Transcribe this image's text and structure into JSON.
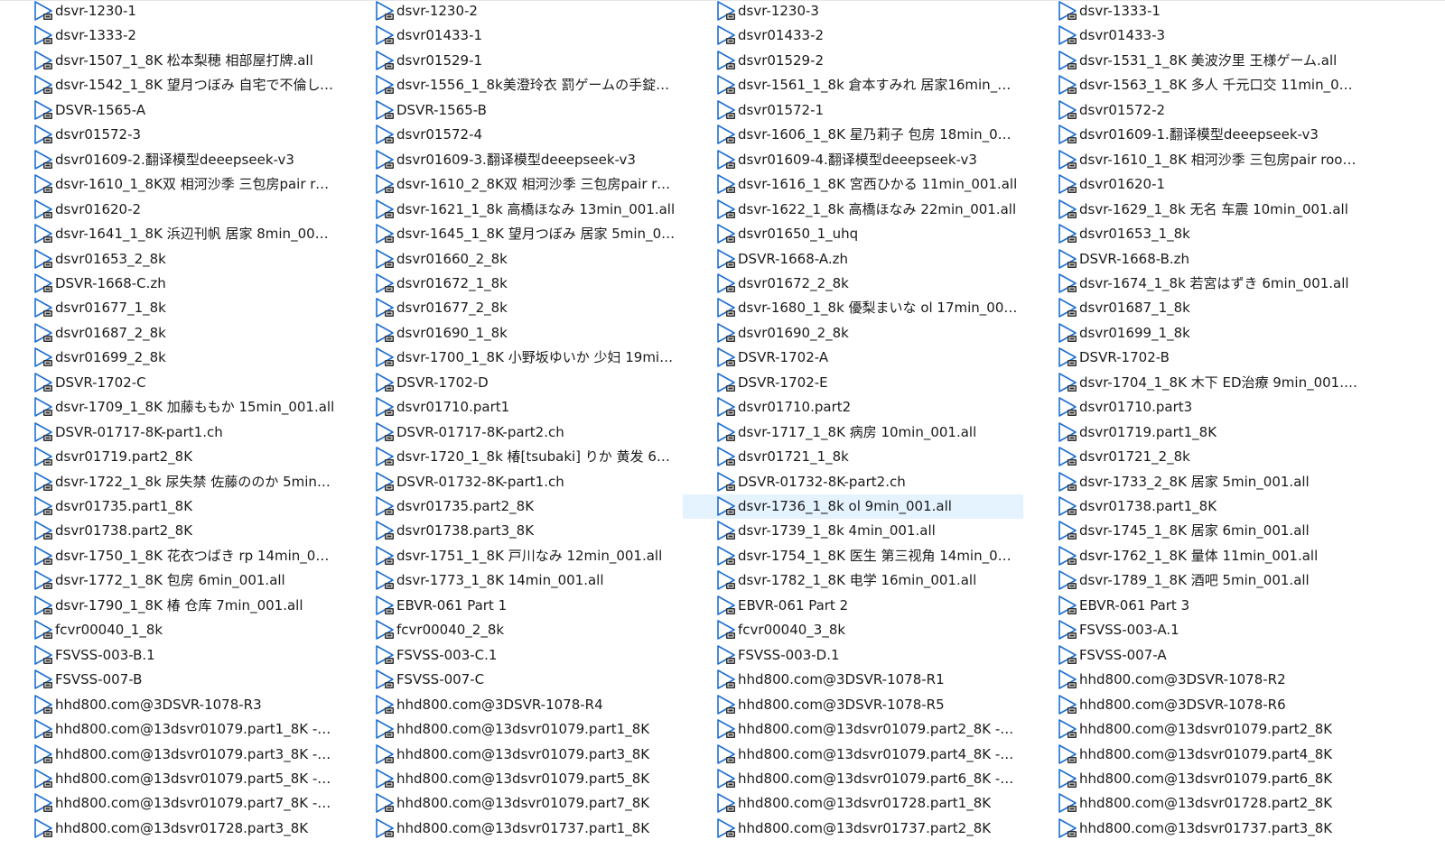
{
  "colors": {
    "selection": "#e5f3ff",
    "icon_blue": "#1f6fd1",
    "icon_dark": "#2b2b2b"
  },
  "icon": "video-file-icon",
  "columns": [
    {
      "items": [
        "dsvr-1230-1",
        "dsvr-1333-2",
        "dsvr-1507_1_8K 松本梨穂 相部屋打牌.all",
        "dsvr-1542_1_8K 望月つぼみ 自宅で不倫して…",
        "DSVR-1565-A",
        "dsvr01572-3",
        "dsvr01609-2.翻译模型deeepseek-v3",
        "dsvr-1610_1_8K双 相河沙季 三包房pair room",
        "dsvr01620-2",
        "dsvr-1641_1_8K 浜辺刊帆 居家 8min_001.all",
        "dsvr01653_2_8k",
        "DSVR-1668-C.zh",
        "dsvr01677_1_8k",
        "dsvr01687_2_8k",
        "dsvr01699_2_8k",
        "DSVR-1702-C",
        "dsvr-1709_1_8K 加藤ももか 15min_001.all",
        "DSVR-01717-8K-part1.ch",
        "dsvr01719.part2_8K",
        "dsvr-1722_1_8k 尿失禁 佐藤ののか 5min_0…",
        "dsvr01735.part1_8K",
        "dsvr01738.part2_8K",
        "dsvr-1750_1_8K 花衣つばき rp 14min_001.…",
        "dsvr-1772_1_8K 包房 6min_001.all",
        "dsvr-1790_1_8K 椿  仓库 7min_001.all",
        "fcvr00040_1_8k",
        "FSVSS-003-B.1",
        "FSVSS-007-B",
        "hhd800.com@3DSVR-1078-R3",
        "hhd800.com@13dsvr01079.part1_8K - 副本",
        "hhd800.com@13dsvr01079.part3_8K - 副本",
        "hhd800.com@13dsvr01079.part5_8K - 副本",
        "hhd800.com@13dsvr01079.part7_8K - 副本",
        "hhd800.com@13dsvr01728.part3_8K"
      ]
    },
    {
      "items": [
        "dsvr-1230-2",
        "dsvr01433-1",
        "dsvr01529-1",
        "dsvr-1556_1_8k美澄玲衣 罰ゲームの手錠が…",
        "DSVR-1565-B",
        "dsvr01572-4",
        "dsvr01609-3.翻译模型deeepseek-v3",
        "dsvr-1610_2_8K双 相河沙季 三包房pair room",
        "dsvr-1621_1_8k 高橋ほなみ 13min_001.all",
        "dsvr-1645_1_8K 望月つぼみ 居家 5min_001…",
        "dsvr01660_2_8k",
        "dsvr01672_1_8k",
        "dsvr01677_2_8k",
        "dsvr01690_1_8k",
        "dsvr-1700_1_8K 小野坂ゆいか 少妇 19min_…",
        "DSVR-1702-D",
        "dsvr01710.part1",
        "DSVR-01717-8K-part2.ch",
        "dsvr-1720_1_8k 椿[tsubaki] りか 黄发 6mi…",
        "DSVR-01732-8K-part1.ch",
        "dsvr01735.part2_8K",
        "dsvr01738.part3_8K",
        "dsvr-1751_1_8K 戸川なみ 12min_001.all",
        "dsvr-1773_1_8K 14min_001.all",
        "EBVR-061 Part 1",
        "fcvr00040_2_8k",
        "FSVSS-003-C.1",
        "FSVSS-007-C",
        "hhd800.com@3DSVR-1078-R4",
        "hhd800.com@13dsvr01079.part1_8K",
        "hhd800.com@13dsvr01079.part3_8K",
        "hhd800.com@13dsvr01079.part5_8K",
        "hhd800.com@13dsvr01079.part7_8K",
        "hhd800.com@13dsvr01737.part1_8K"
      ]
    },
    {
      "items": [
        "dsvr-1230-3",
        "dsvr01433-2",
        "dsvr01529-2",
        "dsvr-1561_1_8k 倉本すみれ 居家16min_00…",
        "dsvr01572-1",
        "dsvr-1606_1_8K 星乃莉子 包房 18min_001.all",
        "dsvr01609-4.翻译模型deeepseek-v3",
        "dsvr-1616_1_8K 宮西ひかる 11min_001.all",
        "dsvr-1622_1_8k 高橋ほなみ 22min_001.all",
        "dsvr01650_1_uhq",
        "DSVR-1668-A.zh",
        "dsvr01672_2_8k",
        "dsvr-1680_1_8k 優梨まいな ol 17min_001.all",
        "dsvr01690_2_8k",
        "DSVR-1702-A",
        "DSVR-1702-E",
        "dsvr01710.part2",
        "dsvr-1717_1_8K 病房 10min_001.all",
        "dsvr01721_1_8k",
        "DSVR-01732-8K-part2.ch",
        "dsvr-1736_1_8k ol 9min_001.all",
        "dsvr-1739_1_8k 4min_001.all",
        "dsvr-1754_1_8K 医生 第三视角 14min_001.all",
        "dsvr-1782_1_8K 电学 16min_001.all",
        "EBVR-061 Part 2",
        "fcvr00040_3_8k",
        "FSVSS-003-D.1",
        "hhd800.com@3DSVR-1078-R1",
        "hhd800.com@3DSVR-1078-R5",
        "hhd800.com@13dsvr01079.part2_8K - 副本",
        "hhd800.com@13dsvr01079.part4_8K - 副本",
        "hhd800.com@13dsvr01079.part6_8K - 副本",
        "hhd800.com@13dsvr01728.part1_8K",
        "hhd800.com@13dsvr01737.part2_8K"
      ]
    },
    {
      "items": [
        "dsvr-1333-1",
        "dsvr01433-3",
        "dsvr-1531_1_8K 美波汐里 王様ゲーム.all",
        "dsvr-1563_1_8K 多人 千元口交 11min_001.all",
        "dsvr01572-2",
        "dsvr01609-1.翻译模型deeepseek-v3",
        "dsvr-1610_1_8K 相河沙季 三包房pair room.…",
        "dsvr01620-1",
        "dsvr-1629_1_8k 无名 车震 10min_001.all",
        "dsvr01653_1_8k",
        "DSVR-1668-B.zh",
        "dsvr-1674_1_8k 若宮はずき 6min_001.all",
        "dsvr01687_1_8k",
        "dsvr01699_1_8k",
        "DSVR-1702-B",
        "dsvr-1704_1_8K 木下 ED治療 9min_001.all",
        "dsvr01710.part3",
        "dsvr01719.part1_8K",
        "dsvr01721_2_8k",
        "dsvr-1733_2_8K 居家 5min_001.all",
        "dsvr01738.part1_8K",
        "dsvr-1745_1_8K 居家 6min_001.all",
        "dsvr-1762_1_8K 量体 11min_001.all",
        "dsvr-1789_1_8K 酒吧 5min_001.all",
        "EBVR-061 Part 3",
        "FSVSS-003-A.1",
        "FSVSS-007-A",
        "hhd800.com@3DSVR-1078-R2",
        "hhd800.com@3DSVR-1078-R6",
        "hhd800.com@13dsvr01079.part2_8K",
        "hhd800.com@13dsvr01079.part4_8K",
        "hhd800.com@13dsvr01079.part6_8K",
        "hhd800.com@13dsvr01728.part2_8K",
        "hhd800.com@13dsvr01737.part3_8K"
      ]
    }
  ],
  "selected": {
    "column": 2,
    "row": 20
  }
}
